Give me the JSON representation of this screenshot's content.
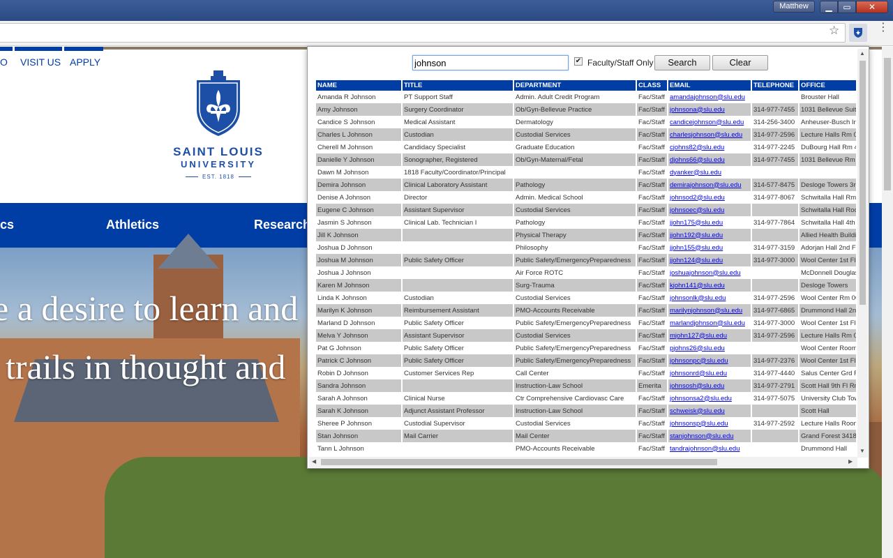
{
  "browser": {
    "user_name": "Matthew",
    "window_buttons": {
      "minimize": "▁",
      "maximize": "▭",
      "close": "✕"
    }
  },
  "page": {
    "top_nav": [
      "O",
      "VISIT US",
      "APPLY"
    ],
    "logo": {
      "line1": "SAINT LOUIS",
      "line2": "UNIVERSITY",
      "est": "EST. 1818"
    },
    "main_nav": [
      "cs",
      "Athletics",
      "Research"
    ],
    "hero_lines": [
      "e a desire to learn and",
      "trails in thought and"
    ]
  },
  "popup": {
    "search_value": "johnson",
    "faculty_staff_only_label": "Faculty/Staff Only",
    "faculty_staff_only_checked": true,
    "search_button": "Search",
    "clear_button": "Clear",
    "columns": [
      "NAME",
      "TITLE",
      "DEPARTMENT",
      "CLASS",
      "EMAIL",
      "TELEPHONE",
      "OFFICE"
    ],
    "rows": [
      [
        "Amanda R Johnson",
        "PT Support Staff",
        "Admin. Adult Credit Program",
        "Fac/Staff",
        "amandajohnson@slu.edu",
        "",
        "Brouster Hall"
      ],
      [
        "Amy Johnson",
        "Surgery Coordinator",
        "Ob/Gyn-Bellevue Practice",
        "Fac/Staff",
        "johnsona@slu.edu",
        "314-977-7455",
        "1031 Bellevue Suite 4"
      ],
      [
        "Candice S Johnson",
        "Medical Assistant",
        "Dermatology",
        "Fac/Staff",
        "candicejohnson@slu.edu",
        "314-256-3400",
        "Anheuser-Busch Insti"
      ],
      [
        "Charles L Johnson",
        "Custodian",
        "Custodial Services",
        "Fac/Staff",
        "charlesjohnson@slu.edu",
        "314-977-2596",
        "Lecture Halls Rm 006"
      ],
      [
        "Cherell M Johnson",
        "Candidacy Specialist",
        "Graduate Education",
        "Fac/Staff",
        "cjohns82@slu.edu",
        "314-977-2245",
        "DuBourg Hall Rm 420"
      ],
      [
        "Danielle Y Johnson",
        "Sonographer, Registered",
        "Ob/Gyn-Maternal/Fetal",
        "Fac/Staff",
        "djohns66@slu.edu",
        "314-977-7455",
        "1031 Bellevue Rm 40"
      ],
      [
        "Dawn M Johnson",
        "1818 Faculty/Coordinator/Principal",
        "",
        "Fac/Staff",
        "dyanker@slu.edu",
        "",
        ""
      ],
      [
        "Demira Johnson",
        "Clinical Laboratory Assistant",
        "Pathology",
        "Fac/Staff",
        "demirajohnson@slu.edu",
        "314-577-8475",
        "Desloge Towers 3rd"
      ],
      [
        "Denise A Johnson",
        "Director",
        "Admin. Medical School",
        "Fac/Staff",
        "johnsod2@slu.edu",
        "314-977-8067",
        "Schwitalla Hall Rm 27"
      ],
      [
        "Eugene C Johnson",
        "Assistant Supervisor",
        "Custodial Services",
        "Fac/Staff",
        "johnsoec@slu.edu",
        "",
        "Schwitalla Hall Room"
      ],
      [
        "Jasmin S Johnson",
        "Clinical Lab. Technician I",
        "Pathology",
        "Fac/Staff",
        "jjohn175@slu.edu",
        "314-977-7864",
        "Schwitalla Hall 4th Fl"
      ],
      [
        "Jill K Johnson",
        "",
        "Physical Therapy",
        "Fac/Staff",
        "jjohn192@slu.edu",
        "",
        "Allied Health Building"
      ],
      [
        "Joshua D Johnson",
        "",
        "Philosophy",
        "Fac/Staff",
        "jjohn155@slu.edu",
        "314-977-3159",
        "Adorjan Hall 2nd Floo"
      ],
      [
        "Joshua M Johnson",
        "Public Safety Officer",
        "Public Safety/EmergencyPreparedness",
        "Fac/Staff",
        "jjohn124@slu.edu",
        "314-977-3000",
        "Wool Center 1st Floo"
      ],
      [
        "Joshua J Johnson",
        "",
        "Air Force ROTC",
        "Fac/Staff",
        "joshuajohnson@slu.edu",
        "",
        "McDonnell Douglas"
      ],
      [
        "Karen M Johnson",
        "",
        "Surg-Trauma",
        "Fac/Staff",
        "kjohn141@slu.edu",
        "",
        "Desloge Towers"
      ],
      [
        "Linda K Johnson",
        "Custodian",
        "Custodial Services",
        "Fac/Staff",
        "johnsonlk@slu.edu",
        "314-977-2596",
        "Wool Center Rm 006"
      ],
      [
        "Marilyn K Johnson",
        "Reimbursement Assistant",
        "PMO-Accounts Receivable",
        "Fac/Staff",
        "marilynjohnson@slu.edu",
        "314-977-6865",
        "Drummond Hall 2nd"
      ],
      [
        "Marland D Johnson",
        "Public Safety Officer",
        "Public Safety/EmergencyPreparedness",
        "Fac/Staff",
        "marlandjohnson@slu.edu",
        "314-977-3000",
        "Wool Center 1st Floo"
      ],
      [
        "Melva Y Johnson",
        "Assistant Supervisor",
        "Custodial Services",
        "Fac/Staff",
        "mjohn127@slu.edu",
        "314-977-2596",
        "Lecture Halls Rm 006"
      ],
      [
        "Pat G Johnson",
        "Public Safety Officer",
        "Public Safety/EmergencyPreparedness",
        "Fac/Staff",
        "pjohns26@slu.edu",
        "",
        "Wool Center Room 1"
      ],
      [
        "Patrick C Johnson",
        "Public Safety Officer",
        "Public Safety/EmergencyPreparedness",
        "Fac/Staff",
        "johnsonpc@slu.edu",
        "314-977-2376",
        "Wool Center 1st Floo"
      ],
      [
        "Robin D Johnson",
        "Customer Services Rep",
        "Call Center",
        "Fac/Staff",
        "johnsonrd@slu.edu",
        "314-977-4440",
        "Salus Center Grd Fl"
      ],
      [
        "Sandra Johnson",
        "",
        "Instruction-Law School",
        "Emerita",
        "johnsosh@slu.edu",
        "314-977-2791",
        "Scott Hall 9th Fl Rm 9"
      ],
      [
        "Sarah A Johnson",
        "Clinical Nurse",
        "Ctr Comprehensive Cardiovasc Care",
        "Fac/Staff",
        "johnsonsa2@slu.edu",
        "314-977-5075",
        "University Club Towe"
      ],
      [
        "Sarah K Johnson",
        "Adjunct Assistant Professor",
        "Instruction-Law School",
        "Fac/Staff",
        "schweisk@slu.edu",
        "",
        "Scott Hall"
      ],
      [
        "Sheree P Johnson",
        "Custodial Supervisor",
        "Custodial Services",
        "Fac/Staff",
        "johnsonsp@slu.edu",
        "314-977-2592",
        "Lecture Halls Room 0"
      ],
      [
        "Stan Johnson",
        "Mail Carrier",
        "Mail Center",
        "Fac/Staff",
        "stanjohnson@slu.edu",
        "",
        "Grand Forest 3418"
      ],
      [
        "Tann L Johnson",
        "",
        "PMO-Accounts Receivable",
        "Fac/Staff",
        "tandrajohnson@slu.edu",
        "",
        "Drummond Hall"
      ]
    ]
  }
}
